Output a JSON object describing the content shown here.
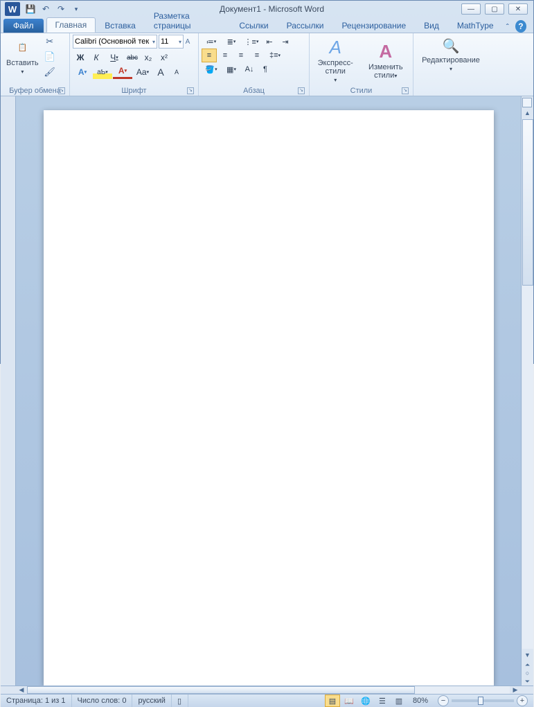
{
  "title": {
    "doc": "Документ1",
    "sep": " - ",
    "app": "Microsoft Word"
  },
  "tabs": {
    "file": "Файл",
    "items": [
      "Главная",
      "Вставка",
      "Разметка страницы",
      "Ссылки",
      "Рассылки",
      "Рецензирование",
      "Вид",
      "MathType"
    ],
    "active": 0
  },
  "ribbon": {
    "clipboard": {
      "paste": "Вставить",
      "label": "Буфер обмена"
    },
    "font": {
      "name": "Calibri (Основной тек",
      "size": "11",
      "label": "Шрифт",
      "bold": "Ж",
      "italic": "К",
      "under": "Ч",
      "strike": "abc",
      "sub": "x₂",
      "sup": "x²",
      "effects": "A",
      "highlight": "aƄ",
      "fontcolor": "A",
      "case": "Aa",
      "grow": "A",
      "shrink": "A",
      "clear": "⌫"
    },
    "para": {
      "label": "Абзац",
      "bullets": "•",
      "numbers": "1",
      "multi": "≡",
      "dec": "⇤",
      "inc": "⇥",
      "left": "≡",
      "center": "≡",
      "right": "≡",
      "just": "≡",
      "spacing": "↕",
      "shade": "▦",
      "border": "▭",
      "sort": "A↓",
      "marks": "¶"
    },
    "styles": {
      "label": "Стили",
      "quick": "Экспресс-стили",
      "change": "Изменить\nстили"
    },
    "edit": {
      "label": "Редактирование"
    }
  },
  "status": {
    "page_label": "Страница:",
    "page_val": "1 из 1",
    "words_label": "Число слов:",
    "words_val": "0",
    "lang": "русский",
    "zoom": "80%"
  }
}
